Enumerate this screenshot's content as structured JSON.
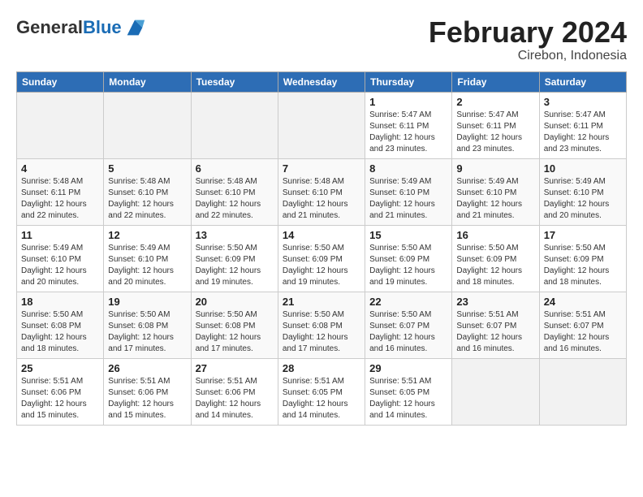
{
  "logo": {
    "general": "General",
    "blue": "Blue"
  },
  "title": "February 2024",
  "location": "Cirebon, Indonesia",
  "days_header": [
    "Sunday",
    "Monday",
    "Tuesday",
    "Wednesday",
    "Thursday",
    "Friday",
    "Saturday"
  ],
  "weeks": [
    [
      {
        "day": "",
        "info": ""
      },
      {
        "day": "",
        "info": ""
      },
      {
        "day": "",
        "info": ""
      },
      {
        "day": "",
        "info": ""
      },
      {
        "day": "1",
        "info": "Sunrise: 5:47 AM\nSunset: 6:11 PM\nDaylight: 12 hours\nand 23 minutes."
      },
      {
        "day": "2",
        "info": "Sunrise: 5:47 AM\nSunset: 6:11 PM\nDaylight: 12 hours\nand 23 minutes."
      },
      {
        "day": "3",
        "info": "Sunrise: 5:47 AM\nSunset: 6:11 PM\nDaylight: 12 hours\nand 23 minutes."
      }
    ],
    [
      {
        "day": "4",
        "info": "Sunrise: 5:48 AM\nSunset: 6:11 PM\nDaylight: 12 hours\nand 22 minutes."
      },
      {
        "day": "5",
        "info": "Sunrise: 5:48 AM\nSunset: 6:10 PM\nDaylight: 12 hours\nand 22 minutes."
      },
      {
        "day": "6",
        "info": "Sunrise: 5:48 AM\nSunset: 6:10 PM\nDaylight: 12 hours\nand 22 minutes."
      },
      {
        "day": "7",
        "info": "Sunrise: 5:48 AM\nSunset: 6:10 PM\nDaylight: 12 hours\nand 21 minutes."
      },
      {
        "day": "8",
        "info": "Sunrise: 5:49 AM\nSunset: 6:10 PM\nDaylight: 12 hours\nand 21 minutes."
      },
      {
        "day": "9",
        "info": "Sunrise: 5:49 AM\nSunset: 6:10 PM\nDaylight: 12 hours\nand 21 minutes."
      },
      {
        "day": "10",
        "info": "Sunrise: 5:49 AM\nSunset: 6:10 PM\nDaylight: 12 hours\nand 20 minutes."
      }
    ],
    [
      {
        "day": "11",
        "info": "Sunrise: 5:49 AM\nSunset: 6:10 PM\nDaylight: 12 hours\nand 20 minutes."
      },
      {
        "day": "12",
        "info": "Sunrise: 5:49 AM\nSunset: 6:10 PM\nDaylight: 12 hours\nand 20 minutes."
      },
      {
        "day": "13",
        "info": "Sunrise: 5:50 AM\nSunset: 6:09 PM\nDaylight: 12 hours\nand 19 minutes."
      },
      {
        "day": "14",
        "info": "Sunrise: 5:50 AM\nSunset: 6:09 PM\nDaylight: 12 hours\nand 19 minutes."
      },
      {
        "day": "15",
        "info": "Sunrise: 5:50 AM\nSunset: 6:09 PM\nDaylight: 12 hours\nand 19 minutes."
      },
      {
        "day": "16",
        "info": "Sunrise: 5:50 AM\nSunset: 6:09 PM\nDaylight: 12 hours\nand 18 minutes."
      },
      {
        "day": "17",
        "info": "Sunrise: 5:50 AM\nSunset: 6:09 PM\nDaylight: 12 hours\nand 18 minutes."
      }
    ],
    [
      {
        "day": "18",
        "info": "Sunrise: 5:50 AM\nSunset: 6:08 PM\nDaylight: 12 hours\nand 18 minutes."
      },
      {
        "day": "19",
        "info": "Sunrise: 5:50 AM\nSunset: 6:08 PM\nDaylight: 12 hours\nand 17 minutes."
      },
      {
        "day": "20",
        "info": "Sunrise: 5:50 AM\nSunset: 6:08 PM\nDaylight: 12 hours\nand 17 minutes."
      },
      {
        "day": "21",
        "info": "Sunrise: 5:50 AM\nSunset: 6:08 PM\nDaylight: 12 hours\nand 17 minutes."
      },
      {
        "day": "22",
        "info": "Sunrise: 5:50 AM\nSunset: 6:07 PM\nDaylight: 12 hours\nand 16 minutes."
      },
      {
        "day": "23",
        "info": "Sunrise: 5:51 AM\nSunset: 6:07 PM\nDaylight: 12 hours\nand 16 minutes."
      },
      {
        "day": "24",
        "info": "Sunrise: 5:51 AM\nSunset: 6:07 PM\nDaylight: 12 hours\nand 16 minutes."
      }
    ],
    [
      {
        "day": "25",
        "info": "Sunrise: 5:51 AM\nSunset: 6:06 PM\nDaylight: 12 hours\nand 15 minutes."
      },
      {
        "day": "26",
        "info": "Sunrise: 5:51 AM\nSunset: 6:06 PM\nDaylight: 12 hours\nand 15 minutes."
      },
      {
        "day": "27",
        "info": "Sunrise: 5:51 AM\nSunset: 6:06 PM\nDaylight: 12 hours\nand 14 minutes."
      },
      {
        "day": "28",
        "info": "Sunrise: 5:51 AM\nSunset: 6:05 PM\nDaylight: 12 hours\nand 14 minutes."
      },
      {
        "day": "29",
        "info": "Sunrise: 5:51 AM\nSunset: 6:05 PM\nDaylight: 12 hours\nand 14 minutes."
      },
      {
        "day": "",
        "info": ""
      },
      {
        "day": "",
        "info": ""
      }
    ]
  ]
}
